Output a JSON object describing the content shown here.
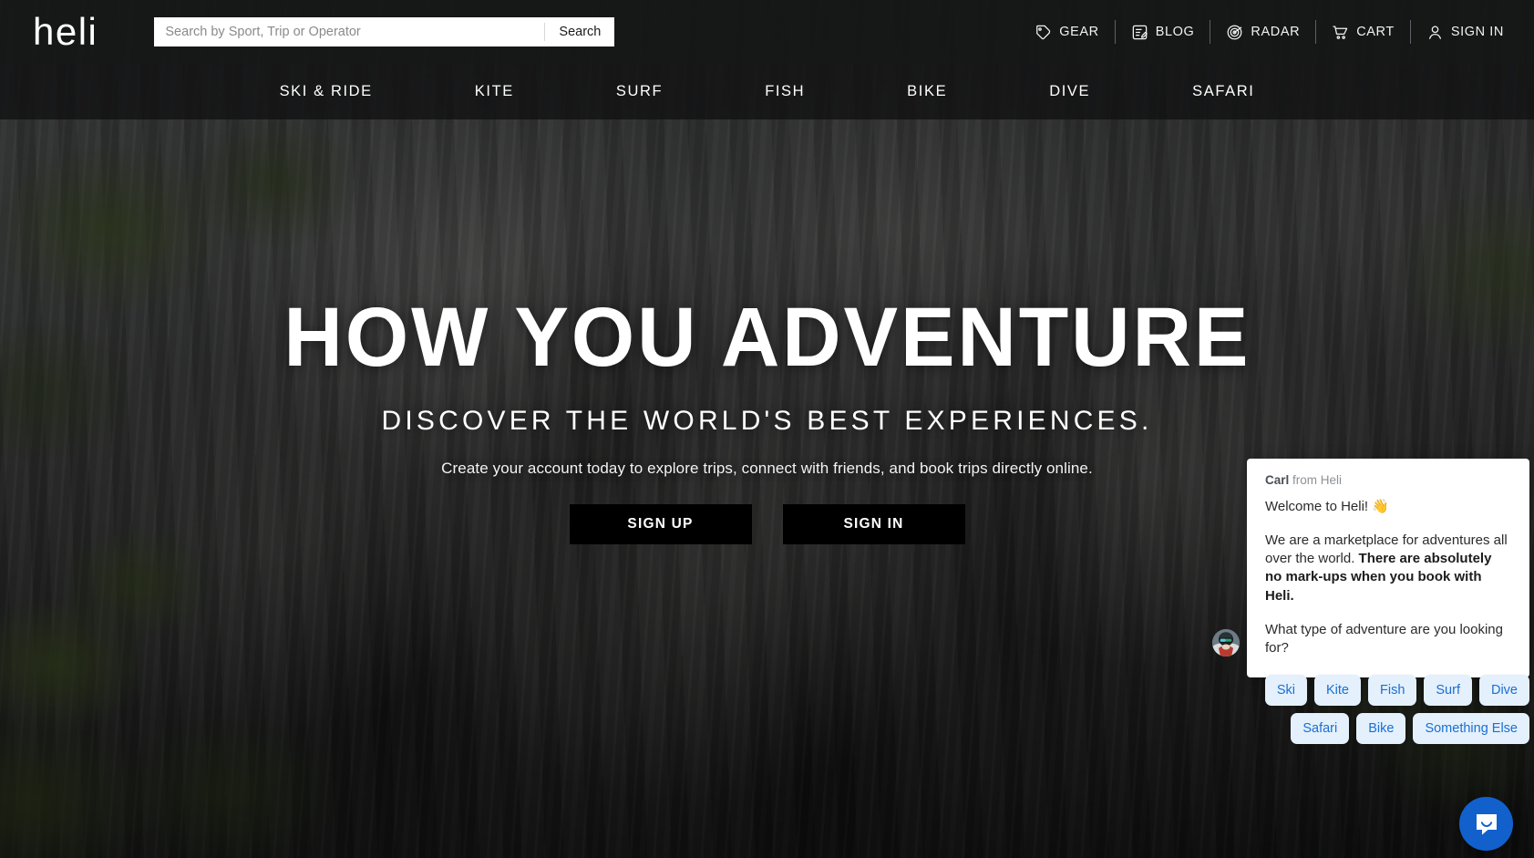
{
  "brand": {
    "logo_text": "heli"
  },
  "search": {
    "placeholder": "Search by Sport, Trip or Operator",
    "value": "",
    "button_label": "Search"
  },
  "topnav": {
    "items": [
      {
        "label": "GEAR",
        "icon": "tag-icon"
      },
      {
        "label": "BLOG",
        "icon": "blog-document-icon"
      },
      {
        "label": "RADAR",
        "icon": "radar-icon"
      },
      {
        "label": "CART",
        "icon": "shopping-cart-icon"
      },
      {
        "label": "SIGN IN",
        "icon": "user-icon"
      }
    ]
  },
  "catnav": {
    "items": [
      {
        "label": "SKI & RIDE"
      },
      {
        "label": "KITE"
      },
      {
        "label": "SURF"
      },
      {
        "label": "FISH"
      },
      {
        "label": "BIKE"
      },
      {
        "label": "DIVE"
      },
      {
        "label": "SAFARI"
      }
    ]
  },
  "hero": {
    "title": "HOW YOU ADVENTURE",
    "subtitle": "DISCOVER THE WORLD'S BEST EXPERIENCES.",
    "description": "Create your account today to explore trips, connect with friends, and book trips directly online.",
    "sign_up_label": "SIGN UP",
    "sign_in_label": "SIGN IN"
  },
  "chat": {
    "sender_name": "Carl",
    "sender_suffix": " from Heli",
    "greeting": "Welcome to Heli! 👋",
    "body_lead": "We are a marketplace for adventures all over the world. ",
    "body_bold": "There are absolutely no mark-ups when you book with Heli.",
    "question": "What type of adventure are you looking for?",
    "quick_replies": [
      {
        "label": "Ski"
      },
      {
        "label": "Kite"
      },
      {
        "label": "Fish"
      },
      {
        "label": "Surf"
      },
      {
        "label": "Dive"
      },
      {
        "label": "Safari"
      },
      {
        "label": "Bike"
      },
      {
        "label": "Something Else"
      }
    ],
    "launcher_icon": "chat-bubble-smile-icon",
    "accent_color": "#1260cc",
    "chip_bg_color": "#e4f0fb",
    "chip_text_color": "#1a6fd4"
  }
}
